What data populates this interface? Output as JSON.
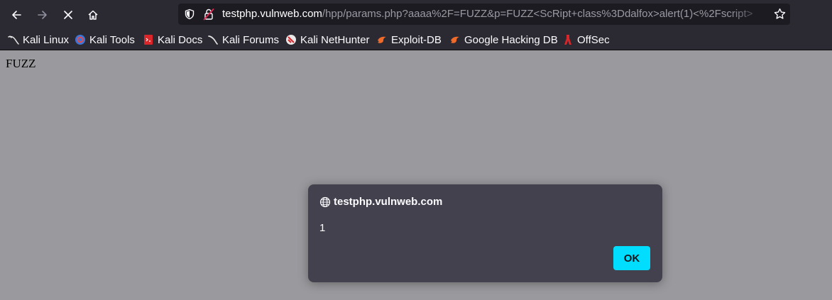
{
  "browser": {
    "url_host": "testphp.vulnweb.com",
    "url_path": "/hpp/params.php?aaaa%2F=FUZZ&p=FUZZ<ScRipt+class%3Ddalfox>alert(1)<%2Fscript>",
    "nav_icons": [
      "back-arrow-icon",
      "forward-arrow-icon",
      "stop-loading-icon",
      "home-icon"
    ],
    "url_icons": [
      "tracking-shield-icon",
      "insecure-lock-icon",
      "bookmark-star-icon"
    ]
  },
  "bookmarks": [
    {
      "label": "Kali Linux",
      "icon": "kali-dragon-icon"
    },
    {
      "label": "Kali Tools",
      "icon": "kali-tools-icon"
    },
    {
      "label": "Kali Docs",
      "icon": "kali-docs-icon"
    },
    {
      "label": "Kali Forums",
      "icon": "kali-forums-icon"
    },
    {
      "label": "Kali NetHunter",
      "icon": "nethunter-icon"
    },
    {
      "label": "Exploit-DB",
      "icon": "exploit-db-icon"
    },
    {
      "label": "Google Hacking DB",
      "icon": "ghdb-icon"
    },
    {
      "label": "OffSec",
      "icon": "offsec-icon"
    }
  ],
  "page": {
    "body_text": "FUZZ"
  },
  "alert": {
    "origin": "testphp.vulnweb.com",
    "message": "1",
    "ok_label": "OK"
  },
  "colors": {
    "toolbar": "#2b2a33",
    "urlbar": "#1c1b22",
    "page_overlay": "#9a9a9e",
    "dialog": "#42414d",
    "ok_button": "#00ddff"
  }
}
